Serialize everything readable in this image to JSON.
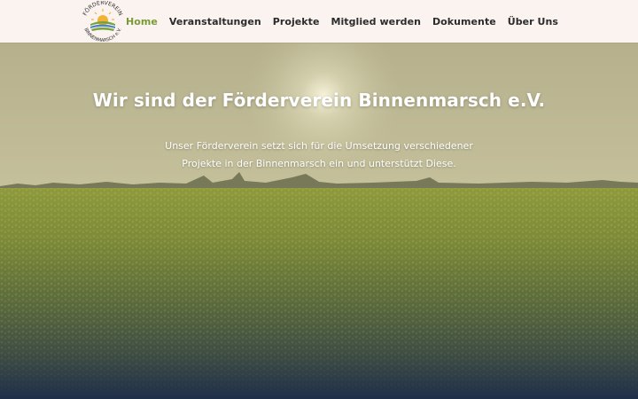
{
  "header": {
    "logo": {
      "text_top": "FÖRDERVEREIN",
      "text_bottom": "BINNENMARSCH e.V."
    },
    "nav": [
      {
        "label": "Home",
        "active": true
      },
      {
        "label": "Veranstaltungen"
      },
      {
        "label": "Projekte"
      },
      {
        "label": "Mitglied werden"
      },
      {
        "label": "Dokumente"
      },
      {
        "label": "Über Uns"
      }
    ]
  },
  "hero": {
    "title": "Wir sind der Förderverein Binnenmarsch e.V.",
    "subtitle_line1": "Unser Förderverein setzt sich für die Umsetzung verschiedener",
    "subtitle_line2": "Projekte in der Binnenmarsch ein und unterstützt Diese."
  },
  "colors": {
    "header_bg": "#fbf3ef",
    "nav_active": "#7a9a38",
    "nav_text": "#2b2b2b"
  }
}
